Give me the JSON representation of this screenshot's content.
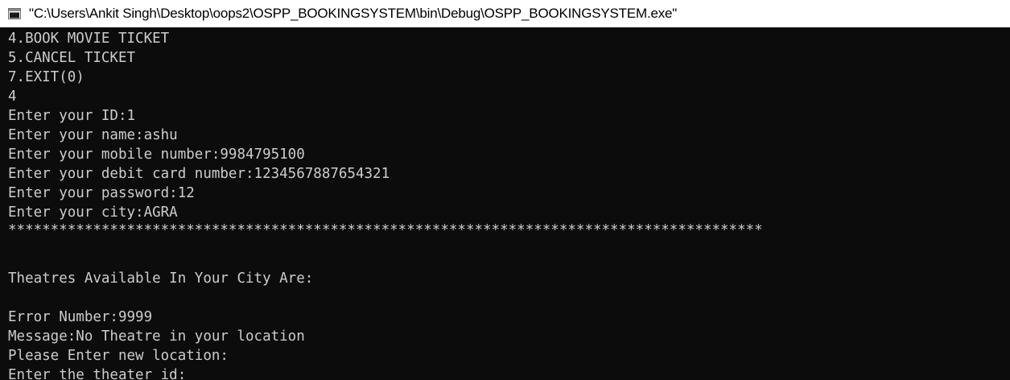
{
  "window": {
    "title": "\"C:\\Users\\Ankit Singh\\Desktop\\oops2\\OSPP_BOOKINGSYSTEM\\bin\\Debug\\OSPP_BOOKINGSYSTEM.exe\"",
    "icon": "console-app-icon"
  },
  "console": {
    "lines": [
      "4.BOOK MOVIE TICKET",
      "5.CANCEL TICKET",
      "7.EXIT(0)",
      "4",
      "Enter your ID:1",
      "Enter your name:ashu",
      "Enter your mobile number:9984795100",
      "Enter your debit card number:1234567887654321",
      "Enter your password:12",
      "Enter your city:AGRA",
      "*****************************************************************************************",
      "Theatres Available In Your City Are:",
      "",
      "Error Number:9999",
      "Message:No Theatre in your location",
      "Please Enter new location:",
      "Enter the theater id:"
    ]
  },
  "colors": {
    "console_bg": "#0c0c0c",
    "console_text": "#cccccc",
    "titlebar_bg": "#ffffff"
  }
}
